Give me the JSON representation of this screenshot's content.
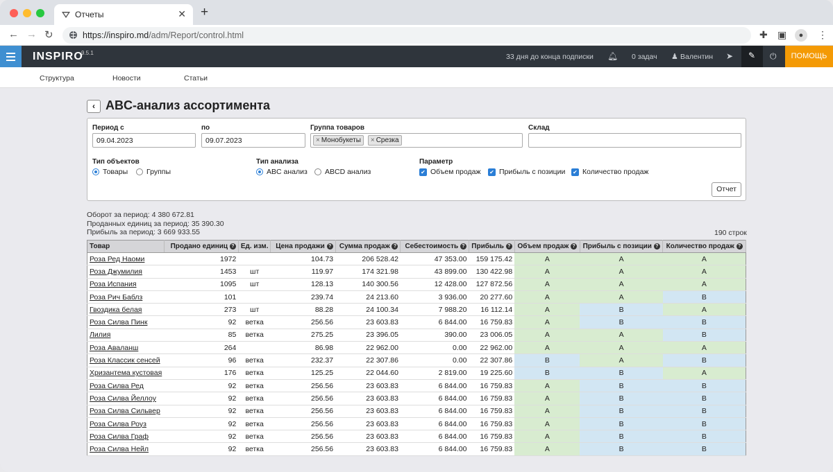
{
  "browser": {
    "tab_title": "Отчеты",
    "url_host": "https://inspiro.md",
    "url_path": "/adm/Report/control.html"
  },
  "header": {
    "brand": "INSPIRO",
    "version": "9.5.1",
    "subscription": "33 дня до конца подписки",
    "tasks": "0 задач",
    "user": "Валентин",
    "help": "ПОМОЩЬ"
  },
  "subnav": [
    "Структура",
    "Новости",
    "Статьи"
  ],
  "page": {
    "title": "ABC-анализ ассортимента"
  },
  "filters": {
    "period_from_label": "Период с",
    "period_from": "09.04.2023",
    "period_to_label": "по",
    "period_to": "09.07.2023",
    "group_label": "Группа товаров",
    "group_tags": [
      "Монобукеты",
      "Срезка"
    ],
    "warehouse_label": "Склад",
    "object_type_label": "Тип объектов",
    "object_type_options": [
      "Товары",
      "Группы"
    ],
    "analysis_type_label": "Тип анализа",
    "analysis_type_options": [
      "ABC анализ",
      "ABCD анализ"
    ],
    "param_label": "Параметр",
    "param_options": [
      "Объем продаж",
      "Прибыль с позиции",
      "Количество продаж"
    ],
    "report_button": "Отчет"
  },
  "summary": {
    "turnover": "Оборот за период: 4 380 672.81",
    "units": "Проданных единиц за период: 35 390.30",
    "profit": "Прибыль за период: 3 669 933.55",
    "rows": "190 строк"
  },
  "colors": {
    "class_A": "#d8ecd0",
    "class_B": "#d2e6f3"
  },
  "table": {
    "headers": [
      "Товар",
      "Продано единиц",
      "Ед. изм.",
      "Цена продажи",
      "Сумма продаж",
      "Себестоимость",
      "Прибыль",
      "Объем продаж",
      "Прибыль с позиции",
      "Количество продаж"
    ],
    "rows": [
      [
        "Роза Ред Наоми",
        "1972",
        "",
        "104.73",
        "206 528.42",
        "47 353.00",
        "159 175.42",
        "A",
        "A",
        "A"
      ],
      [
        "Роза Джумилия",
        "1453",
        "шт",
        "119.97",
        "174 321.98",
        "43 899.00",
        "130 422.98",
        "A",
        "A",
        "A"
      ],
      [
        "Роза Испания",
        "1095",
        "шт",
        "128.13",
        "140 300.56",
        "12 428.00",
        "127 872.56",
        "A",
        "A",
        "A"
      ],
      [
        "Роза Рич Баблз",
        "101",
        "",
        "239.74",
        "24 213.60",
        "3 936.00",
        "20 277.60",
        "A",
        "A",
        "B"
      ],
      [
        "Гвоздика белая",
        "273",
        "шт",
        "88.28",
        "24 100.34",
        "7 988.20",
        "16 112.14",
        "A",
        "B",
        "A"
      ],
      [
        "Роза Силва Пинк",
        "92",
        "ветка",
        "256.56",
        "23 603.83",
        "6 844.00",
        "16 759.83",
        "A",
        "B",
        "B"
      ],
      [
        "Лилия",
        "85",
        "ветка",
        "275.25",
        "23 396.05",
        "390.00",
        "23 006.05",
        "A",
        "A",
        "B"
      ],
      [
        "Роза Аваланш",
        "264",
        "",
        "86.98",
        "22 962.00",
        "0.00",
        "22 962.00",
        "A",
        "A",
        "A"
      ],
      [
        "Роза Классик сенсей",
        "96",
        "ветка",
        "232.37",
        "22 307.86",
        "0.00",
        "22 307.86",
        "B",
        "A",
        "B"
      ],
      [
        "Хризантема кустовая",
        "176",
        "ветка",
        "125.25",
        "22 044.60",
        "2 819.00",
        "19 225.60",
        "B",
        "B",
        "A"
      ],
      [
        "Роза Силва Ред",
        "92",
        "ветка",
        "256.56",
        "23 603.83",
        "6 844.00",
        "16 759.83",
        "A",
        "B",
        "B"
      ],
      [
        "Роза Силва Йеллоу",
        "92",
        "ветка",
        "256.56",
        "23 603.83",
        "6 844.00",
        "16 759.83",
        "A",
        "B",
        "B"
      ],
      [
        "Роза Силва Сильвер",
        "92",
        "ветка",
        "256.56",
        "23 603.83",
        "6 844.00",
        "16 759.83",
        "A",
        "B",
        "B"
      ],
      [
        "Роза Силва Роуз",
        "92",
        "ветка",
        "256.56",
        "23 603.83",
        "6 844.00",
        "16 759.83",
        "A",
        "B",
        "B"
      ],
      [
        "Роза Силва Граф",
        "92",
        "ветка",
        "256.56",
        "23 603.83",
        "6 844.00",
        "16 759.83",
        "A",
        "B",
        "B"
      ],
      [
        "Роза Силва Нейл",
        "92",
        "ветка",
        "256.56",
        "23 603.83",
        "6 844.00",
        "16 759.83",
        "A",
        "B",
        "B"
      ]
    ]
  }
}
